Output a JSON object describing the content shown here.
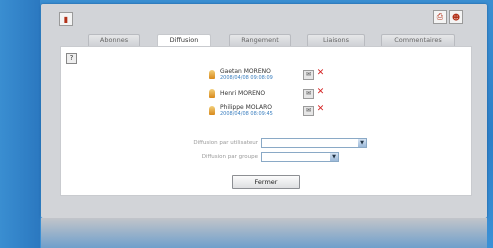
{
  "tabs": [
    {
      "label": "Abonnes"
    },
    {
      "label": "Diffusion",
      "active": true
    },
    {
      "label": "Rangement"
    },
    {
      "label": "Liaisons"
    },
    {
      "label": "Commentaires"
    }
  ],
  "help_label": "?",
  "users": [
    {
      "name": "Gaetan MORENO",
      "date": "2008/04/08 09:08:09"
    },
    {
      "name": "Henri MORENO",
      "date": ""
    },
    {
      "name": "Philippe MOLARO",
      "date": "2008/04/08 08:09:45"
    }
  ],
  "form": {
    "user_label": "Diffusion par utilisateur",
    "group_label": "Diffusion par groupe",
    "user_value": "",
    "group_value": ""
  },
  "close_button": "Fermer",
  "colors": {
    "accent_blue": "#2c7fc8",
    "delete_red": "#d42121"
  }
}
